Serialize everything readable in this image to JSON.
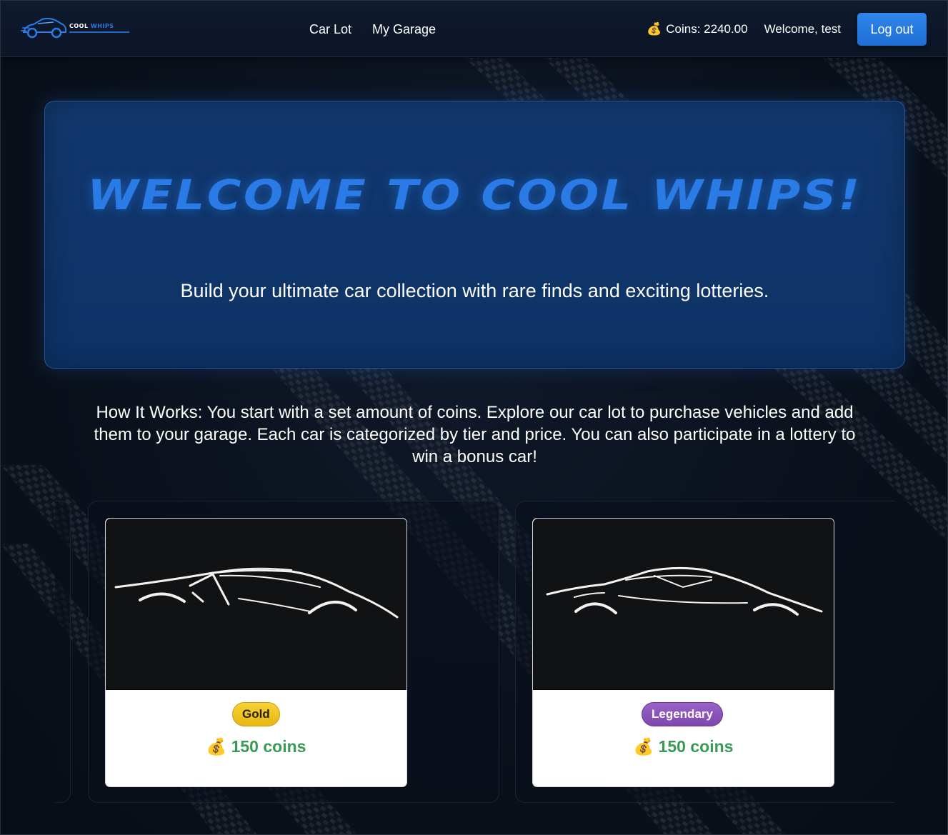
{
  "colors": {
    "accent": "#2a7be6",
    "hero_bg": "#11386e",
    "page_bg": "#0b101b",
    "price_green": "#3a9a55",
    "gold_badge": "#f2c925",
    "legendary_badge": "#8e55bd"
  },
  "nav": {
    "logo_word_1": "COOL",
    "logo_word_2": "WHIPS",
    "links": [
      {
        "label": "Car Lot"
      },
      {
        "label": "My Garage"
      }
    ],
    "coins_icon": "money-bag-icon",
    "coins_label": "Coins: 2240.00",
    "welcome": "Welcome, test",
    "logout_label": "Log out"
  },
  "hero": {
    "title": "Welcome to Cool Whips!",
    "subtitle": "Build your ultimate car collection with rare finds and exciting lotteries."
  },
  "how_it_works": "How It Works: You start with a set amount of coins. Explore our car lot to purchase vehicles and add them to your garage. Each car is categorized by tier and price. You can also participate in a lottery to win a bonus car!",
  "cars": [
    {
      "tier": "Gold",
      "price_icon": "money-bag-icon",
      "price": "150 coins",
      "image": "car-silhouette-icon"
    },
    {
      "tier": "Legendary",
      "price_icon": "money-bag-icon",
      "price": "150 coins",
      "image": "car-silhouette-icon"
    }
  ]
}
